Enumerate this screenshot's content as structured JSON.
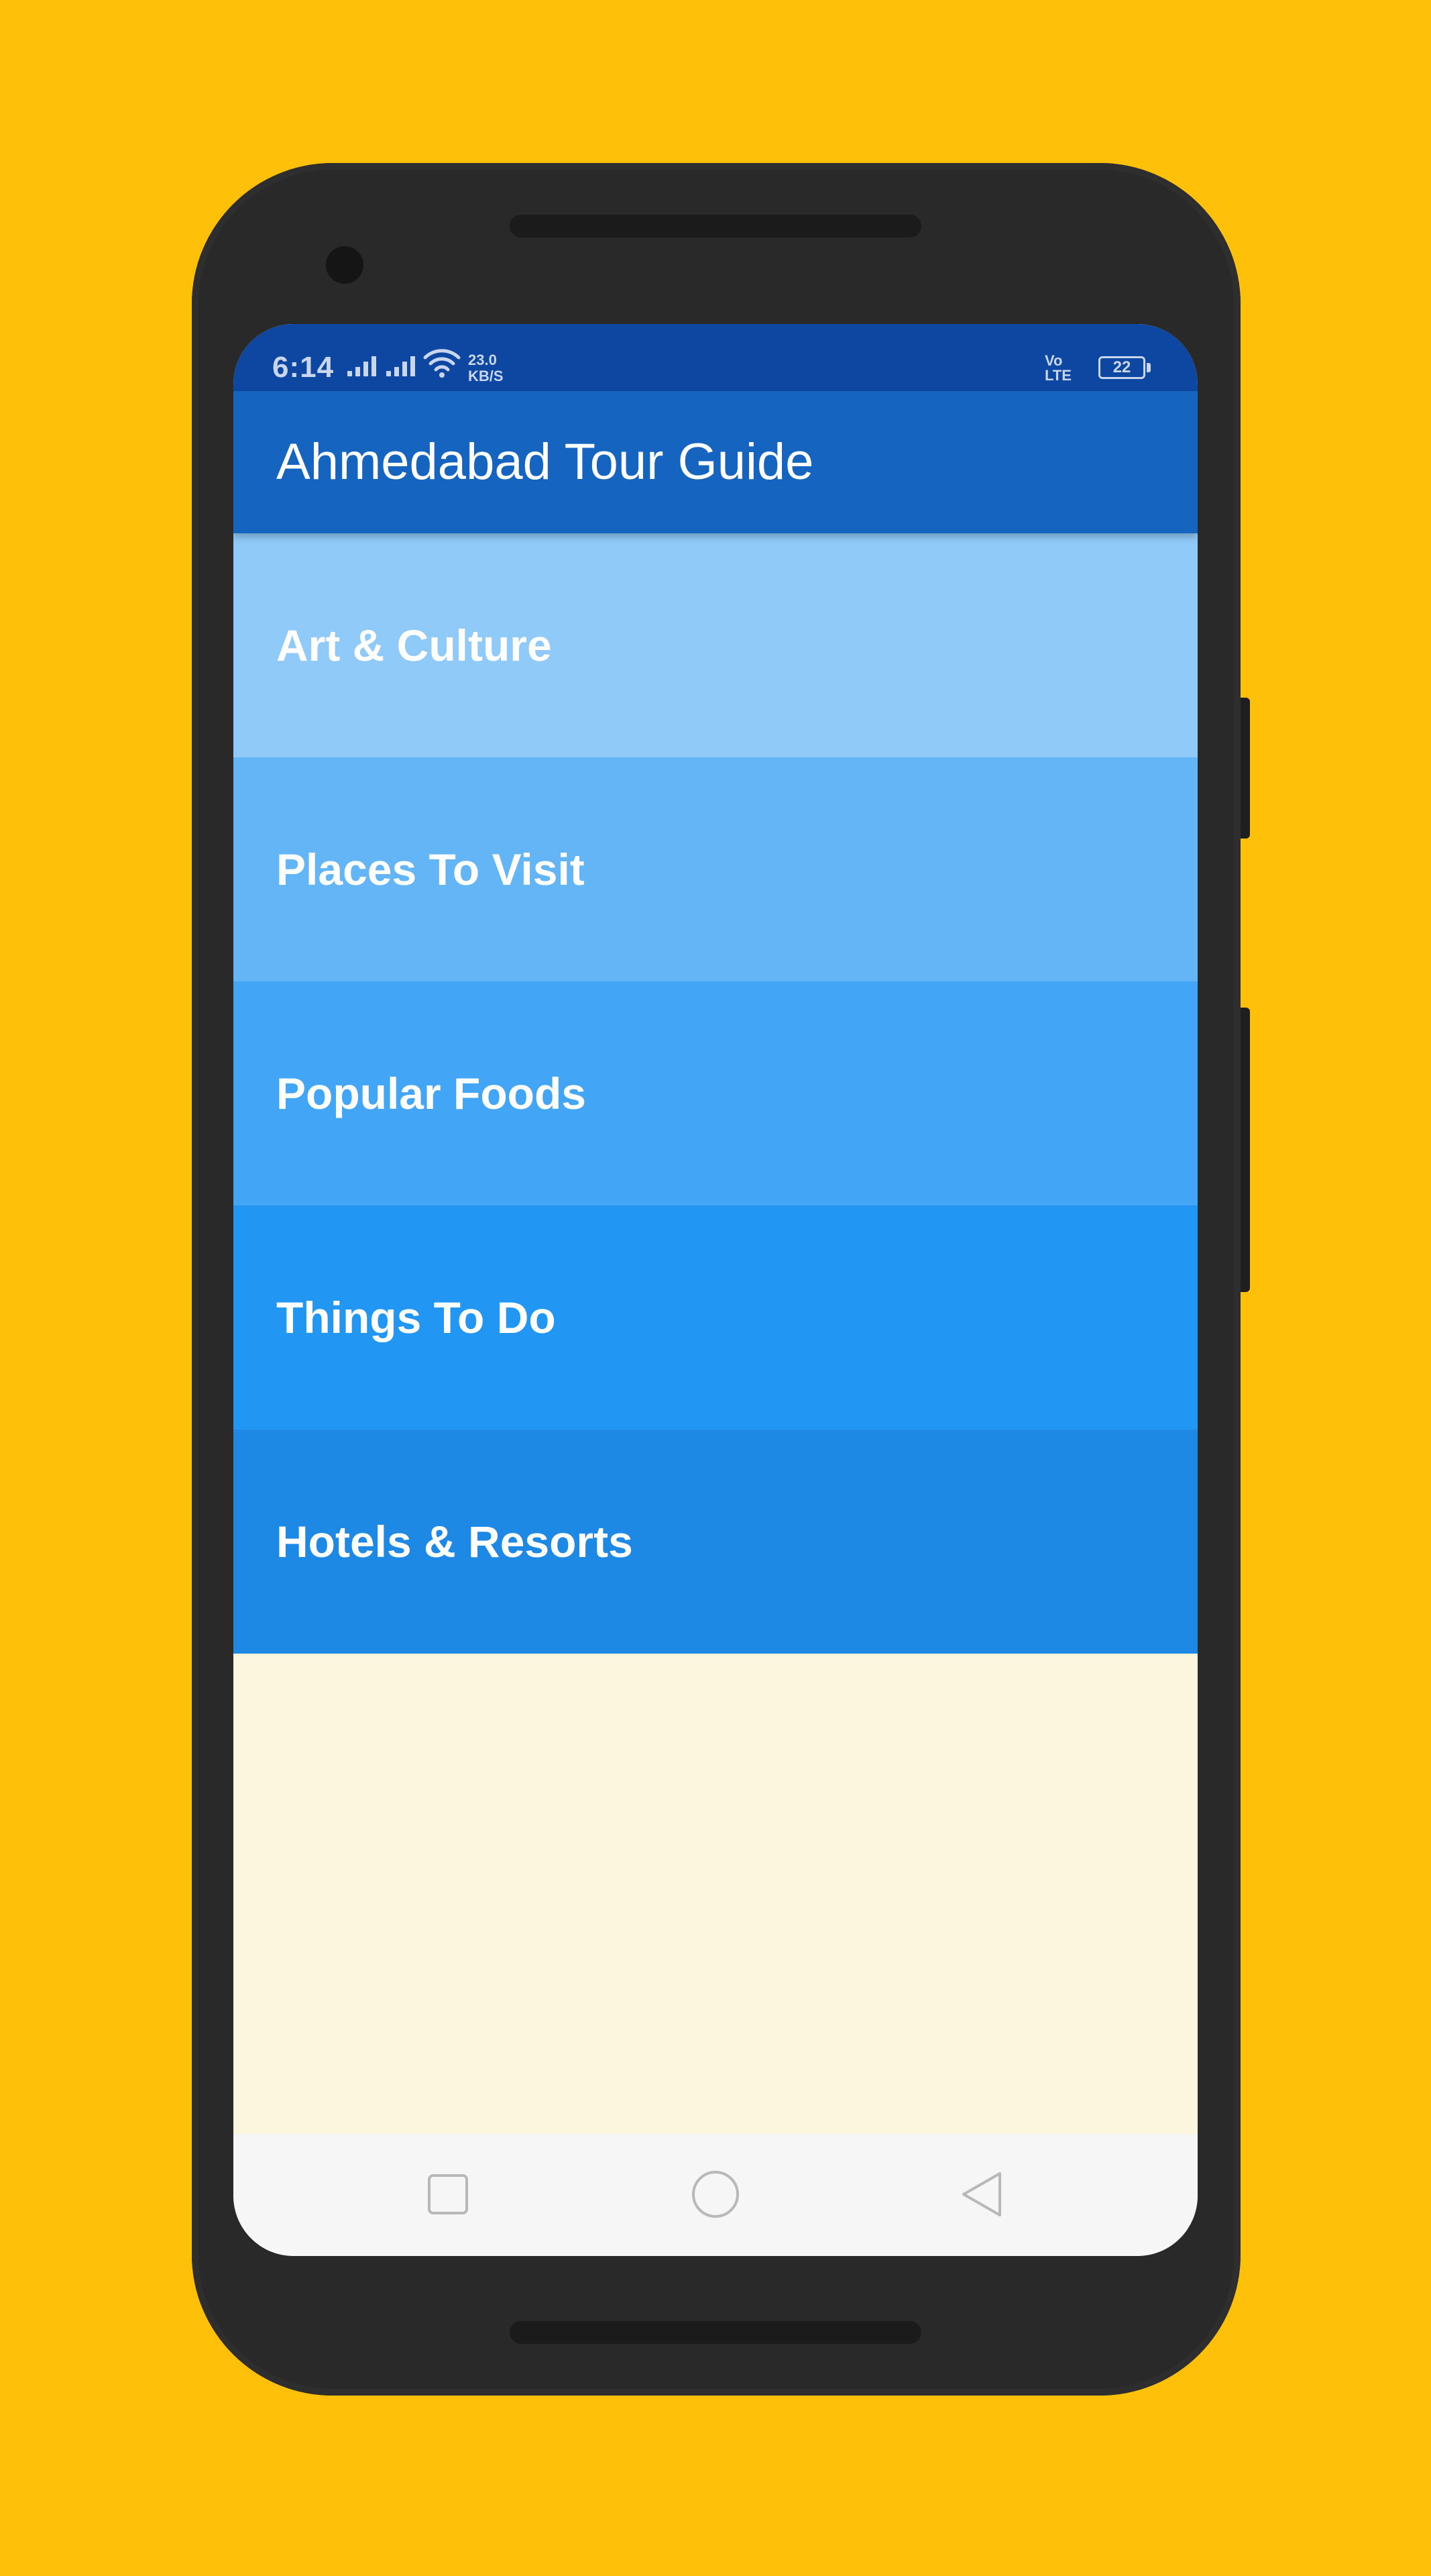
{
  "status_bar": {
    "time": "6:14",
    "net_speed_value": "23.0",
    "net_speed_unit": "KB/S",
    "volte_top": "Vo",
    "volte_bottom": "LTE",
    "battery": "22",
    "color": "#0D47A1"
  },
  "app_bar": {
    "title": "Ahmedabad Tour Guide",
    "color": "#1565C0"
  },
  "categories": [
    {
      "label": "Art & Culture",
      "color": "#90CAF9"
    },
    {
      "label": "Places To Visit",
      "color": "#64B5F6"
    },
    {
      "label": "Popular Foods",
      "color": "#42A5F5"
    },
    {
      "label": "Things To Do",
      "color": "#2196F3"
    },
    {
      "label": "Hotels & Resorts",
      "color": "#1E88E5"
    }
  ],
  "nav_bar": {
    "icons": [
      "recent-apps-icon",
      "home-icon",
      "back-icon"
    ]
  },
  "colors": {
    "background": "#FEC009",
    "content_background": "#FDF6DE"
  }
}
